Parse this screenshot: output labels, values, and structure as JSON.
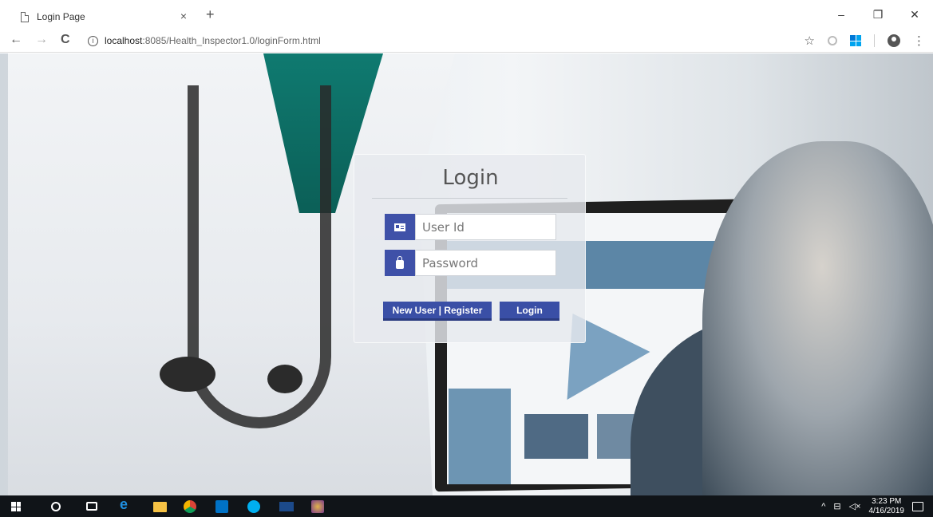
{
  "browser": {
    "tab_title": "Login Page",
    "tab_close": "×",
    "new_tab": "+",
    "url_host": "localhost",
    "url_path": ":8085/Health_Inspector1.0/loginForm.html",
    "window_controls": {
      "minimize": "–",
      "restore": "❐",
      "close": "✕"
    },
    "nav": {
      "back": "←",
      "forward": "→",
      "reload": "C"
    },
    "bookmark_star": "☆",
    "menu_dots": "⋮"
  },
  "login": {
    "title": "Login",
    "user_id_placeholder": "User Id",
    "password_placeholder": "Password",
    "register_button": "New User | Register",
    "login_button": "Login",
    "accent_color": "#3f51a8"
  },
  "taskbar": {
    "time": "3:23 PM",
    "date": "4/16/2019",
    "tray_chevron": "^",
    "tray_network": "⊟",
    "tray_volume": "◁×"
  }
}
